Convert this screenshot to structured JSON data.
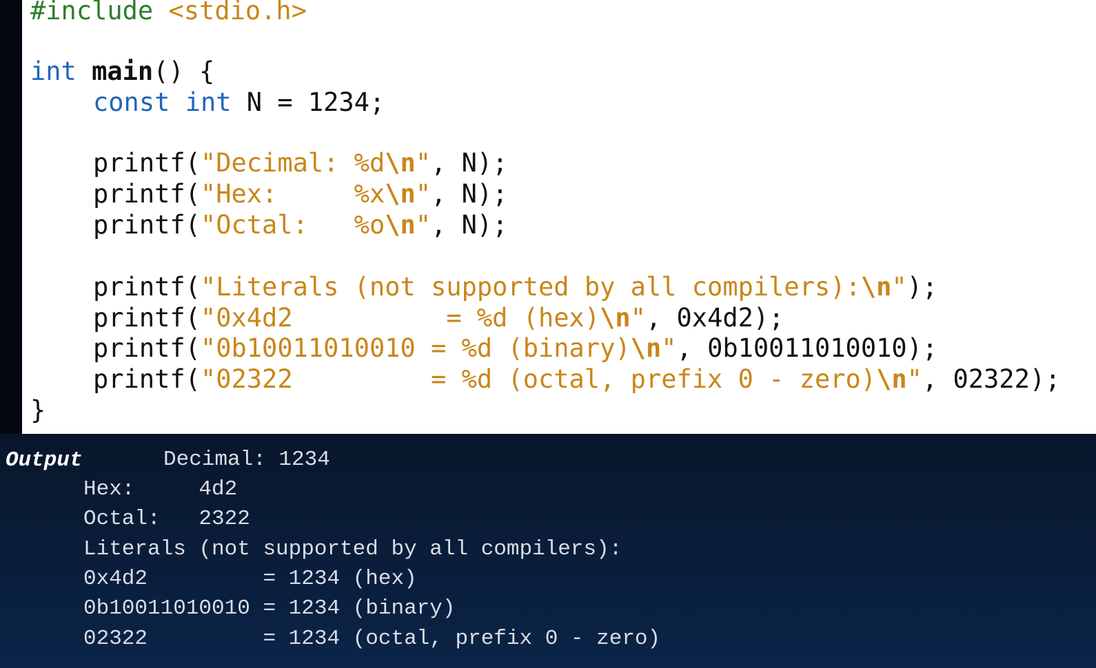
{
  "code": {
    "include_directive": "#include",
    "include_header": " <stdio.h>",
    "main_type": "int",
    "main_name": "main",
    "main_rest": "() {",
    "const_kw": "const",
    "const_type": "int",
    "const_rest": " N = 1234;",
    "printf_decimal": {
      "fn": "printf(",
      "str": "\"Decimal: %d",
      "esc": "\\n",
      "str_end": "\"",
      "args": ", N);"
    },
    "printf_hex": {
      "fn": "printf(",
      "str": "\"Hex:     %x",
      "esc": "\\n",
      "str_end": "\"",
      "args": ", N);"
    },
    "printf_octal": {
      "fn": "printf(",
      "str": "\"Octal:   %o",
      "esc": "\\n",
      "str_end": "\"",
      "args": ", N);"
    },
    "printf_literals": {
      "fn": "printf(",
      "str": "\"Literals (not supported by all compilers):",
      "esc": "\\n",
      "str_end": "\"",
      "args": ");"
    },
    "printf_hex_literal": {
      "fn": "printf(",
      "str": "\"0x4d2          = %d (hex)",
      "esc": "\\n",
      "str_end": "\"",
      "args": ", 0x4d2);"
    },
    "printf_binary_literal": {
      "fn": "printf(",
      "str": "\"0b10011010010 = %d (binary)",
      "esc": "\\n",
      "str_end": "\"",
      "args": ", 0b10011010010);"
    },
    "printf_octal_literal": {
      "fn": "printf(",
      "str": "\"02322         = %d (octal, prefix 0 - zero)",
      "esc": "\\n",
      "str_end": "\"",
      "args": ", 02322);"
    },
    "closing_brace": "}"
  },
  "output": {
    "title": "Output",
    "lines": [
      "Decimal: 1234",
      "Hex:     4d2",
      "Octal:   2322",
      "Literals (not supported by all compilers):",
      "0x4d2         = 1234 (hex)",
      "0b10011010010 = 1234 (binary)",
      "02322         = 1234 (octal, prefix 0 - zero)"
    ]
  }
}
